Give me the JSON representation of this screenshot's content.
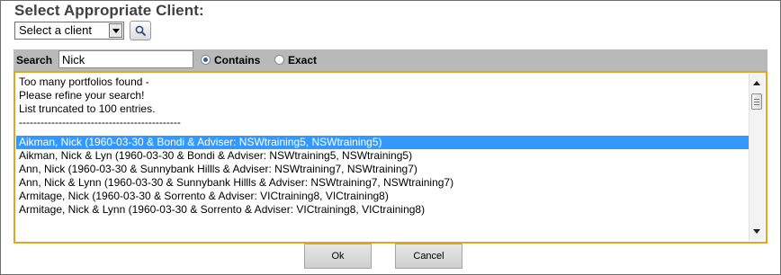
{
  "heading": "Select Appropriate Client:",
  "client_select": {
    "selected": "Select a client"
  },
  "icons": {
    "search": "magnifier-icon",
    "dropdown": "chevron-down-icon"
  },
  "search": {
    "label": "Search",
    "value": "Nick",
    "options": [
      {
        "label": "Contains",
        "selected": true
      },
      {
        "label": "Exact",
        "selected": false
      }
    ]
  },
  "list": {
    "messages": [
      "Too many portfolios found -",
      "Please refine your search!",
      "List truncated to 100 entries.",
      "---------------------------------------------"
    ],
    "items": [
      "Aikman, Nick (1960-03-30 & Bondi & Adviser: NSWtraining5, NSWtraining5)",
      "Aikman, Nick & Lyn (1960-03-30 & Bondi & Adviser: NSWtraining5, NSWtraining5)",
      "Ann, Nick (1960-03-30 & Sunnybank Hillls & Adviser: NSWtraining7, NSWtraining7)",
      "Ann, Nick & Lynn (1960-03-30 & Sunnybank Hillls & Adviser: NSWtraining7, NSWtraining7)",
      "Armitage, Nick (1960-03-30 & Sorrento & Adviser: VICtraining8, VICtraining8)",
      "Armitage, Nick & Lynn (1960-03-30 & Sorrento & Adviser: VICtraining8, VICtraining8)"
    ],
    "selected_index": 0
  },
  "buttons": {
    "ok": "Ok",
    "cancel": "Cancel"
  },
  "colors": {
    "selection": "#3399ff",
    "list_border": "#e3a424",
    "search_bar": "#b9b9b9"
  }
}
